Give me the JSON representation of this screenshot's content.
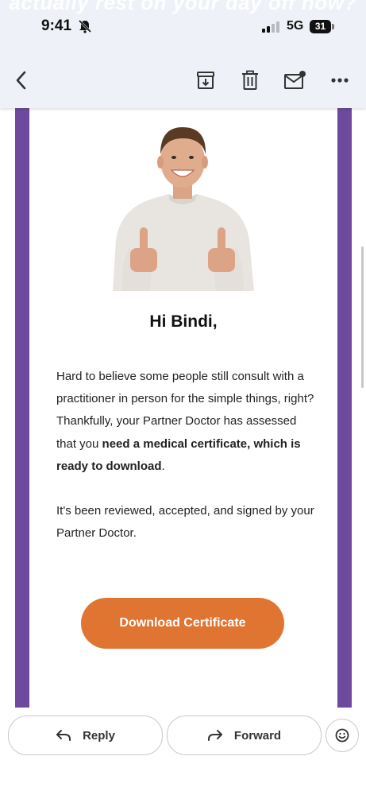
{
  "status_bar": {
    "time": "9:41",
    "network": "5G",
    "battery": "31"
  },
  "header_ghost_text": "actually rest on your day off now?",
  "toolbar": {
    "back_icon": "chevron-left-icon",
    "archive_icon": "archive-icon",
    "delete_icon": "trash-icon",
    "mark_unread_icon": "mail-unread-icon",
    "more_icon": "more-horizontal-icon"
  },
  "email": {
    "frame_color": "#6d4a9e",
    "greeting": "Hi Bindi,",
    "paragraph1": "Hard to believe some people still consult with a practitioner in person for the simple things, right?",
    "paragraph2_start": "Thankfully, your Partner Doctor has assessed that you ",
    "paragraph2_bold": "need a medical certificate, which is ready to download",
    "paragraph2_end": ".",
    "paragraph3": "It's been reviewed, accepted, and signed by your Partner Doctor.",
    "cta_label": "Download Certificate",
    "cta_color": "#e07431"
  },
  "actions": {
    "reply_label": "Reply",
    "forward_label": "Forward",
    "emoji_icon": "smiley-icon"
  }
}
